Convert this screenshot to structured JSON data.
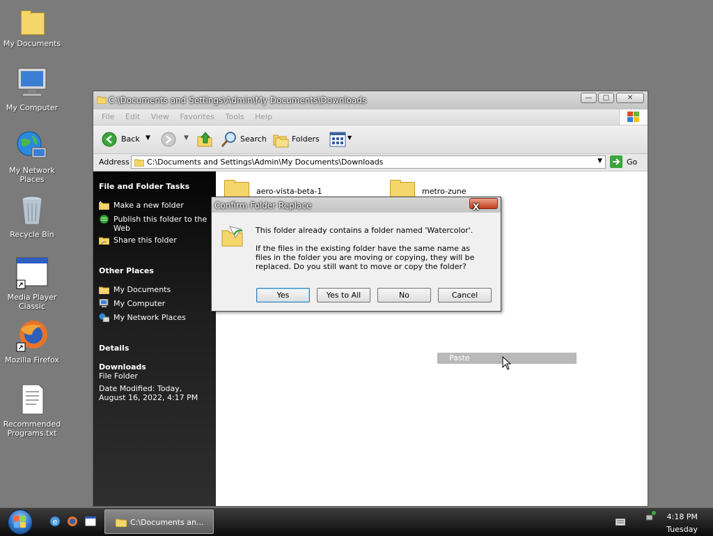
{
  "desktop": {
    "icons": [
      {
        "label": "My Documents"
      },
      {
        "label": "My Computer"
      },
      {
        "label": "My Network Places"
      },
      {
        "label": "Recycle Bin"
      },
      {
        "label": "Media Player Classic"
      },
      {
        "label": "Mozilla Firefox"
      },
      {
        "label": "Recommended Programs.txt"
      }
    ]
  },
  "window": {
    "title": "C:\\Documents and Settings\\Admin\\My Documents\\Downloads",
    "menu": [
      "File",
      "Edit",
      "View",
      "Favorites",
      "Tools",
      "Help"
    ],
    "toolbar": {
      "back_label": "Back",
      "search_label": "Search",
      "folders_label": "Folders"
    },
    "address": {
      "label": "Address",
      "value": "C:\\Documents and Settings\\Admin\\My Documents\\Downloads",
      "go_label": "Go"
    },
    "sidepane": {
      "file_tasks_heading": "File and Folder Tasks",
      "file_tasks": [
        "Make a new folder",
        "Publish this folder to the Web",
        "Share this folder"
      ],
      "other_places_heading": "Other Places",
      "other_places": [
        "My Documents",
        "My Computer",
        "My Network Places"
      ],
      "details_heading": "Details",
      "details_name": "Downloads",
      "details_type": "File Folder",
      "details_modified": "Date Modified: Today, August 16, 2022, 4:17 PM"
    },
    "content": {
      "folders": [
        "aero-vista-beta-1",
        "metro-zune"
      ]
    }
  },
  "dialog": {
    "title": "Confirm Folder Replace",
    "close_label": "X",
    "message_line1": "This folder already contains a folder named 'Watercolor'.",
    "message_line2": "If the files in the existing folder have the same name as files in the folder you are moving or copying, they will be replaced.  Do you still want to move or copy the folder?",
    "buttons": {
      "yes": "Yes",
      "yes_to_all": "Yes to All",
      "no": "No",
      "cancel": "Cancel"
    }
  },
  "context_menu": {
    "paste_label": "Paste"
  },
  "taskbar": {
    "task_label": "C:\\Documents an...",
    "time": "4:18 PM",
    "day": "Tuesday"
  },
  "colors": {
    "desktop": "#7b7b7b",
    "sidepane": "#1d1d1d",
    "folder": "#f5d66a",
    "close_button": "#c4401c"
  }
}
